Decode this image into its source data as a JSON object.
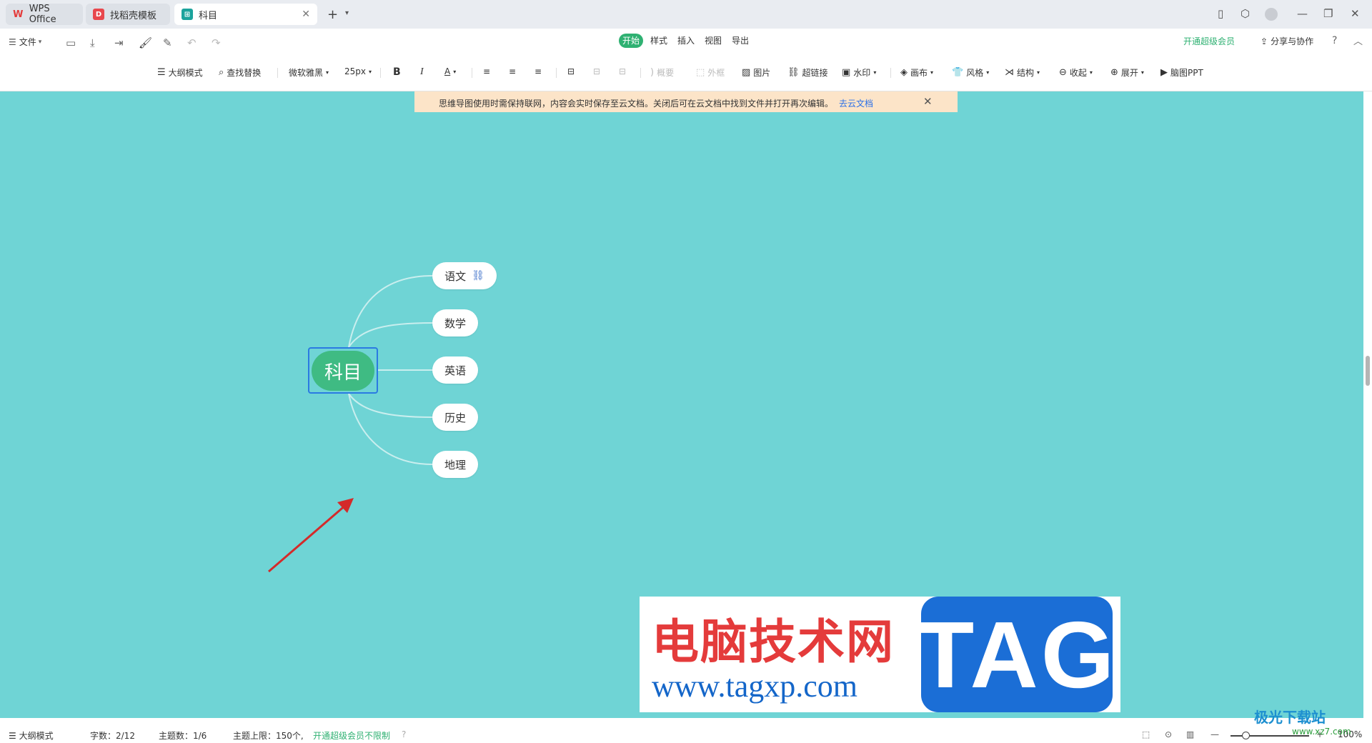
{
  "tabs": [
    {
      "label": "WPS Office",
      "icon": "wps-logo-icon"
    },
    {
      "label": "找稻壳模板",
      "icon": "docer-icon"
    },
    {
      "label": "科目",
      "icon": "mindmap-icon"
    }
  ],
  "menu": {
    "file_label": "文件",
    "tabs": [
      "开始",
      "样式",
      "插入",
      "视图",
      "导出"
    ],
    "vip_label": "开通超级会员",
    "share_label": "分享与协作"
  },
  "toolbar": {
    "outline_mode": "大纲模式",
    "find_replace": "查找替换",
    "font": "微软雅黑",
    "font_size": "25px",
    "summary": "概要",
    "frame": "外框",
    "image": "图片",
    "hyperlink": "超链接",
    "watermark": "水印",
    "canvas": "画布",
    "style": "风格",
    "structure": "结构",
    "collapse": "收起",
    "expand": "展开",
    "to_ppt": "脑图PPT"
  },
  "notice": {
    "text": "思维导图使用时需保持联网，内容会实时保存至云文档。关闭后可在云文档中找到文件并打开再次编辑。",
    "link": "去云文档"
  },
  "mindmap": {
    "root": "科目",
    "children": [
      "语文",
      "数学",
      "英语",
      "历史",
      "地理"
    ]
  },
  "watermark": {
    "title": "电脑技术网",
    "url": "www.tagxp.com",
    "tag": "TAG"
  },
  "statusbar": {
    "outline_mode": "大纲模式",
    "word_count": "字数：2/12",
    "topic_count": "主题数：1/6",
    "topic_limit": "主题上限：150个,",
    "vip_unlimited": "开通超级会员不限制",
    "zoom": "100%"
  },
  "corner_logo": {
    "name": "极光下载站",
    "url": "www.xz7.com"
  },
  "colors": {
    "canvas_bg": "#6fd4d5",
    "root_node": "#3fbb83",
    "accent_green": "#2fb172",
    "selection": "#2a7ae2",
    "arrow": "#d42a2a"
  }
}
